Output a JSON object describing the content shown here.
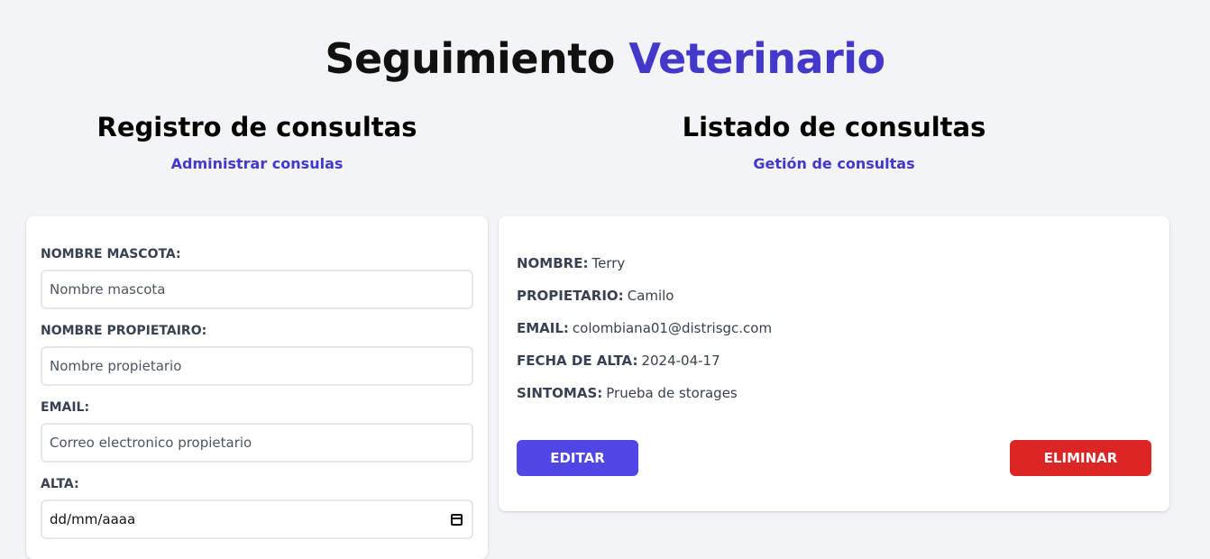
{
  "header": {
    "title_part1": "Seguimiento",
    "title_part2": "Veterinario"
  },
  "registro": {
    "title": "Registro de consultas",
    "subtitle": "Administrar consulas"
  },
  "listado": {
    "title": "Listado de consultas",
    "subtitle": "Getión de consultas"
  },
  "form": {
    "mascota": {
      "label": "Nombre Mascota:",
      "placeholder": "Nombre mascota"
    },
    "propietario": {
      "label": "Nombre Propietairo:",
      "placeholder": "Nombre propietario"
    },
    "email": {
      "label": "Email:",
      "placeholder": "Correo electronico propietario"
    },
    "alta": {
      "label": "Alta:",
      "value": "dd/mm/aaaa"
    }
  },
  "consulta": {
    "nombre": {
      "key": "Nombre:",
      "value": "Terry"
    },
    "propietario": {
      "key": "Propietario:",
      "value": "Camilo"
    },
    "email": {
      "key": "Email:",
      "value": "colombiana01@distrisgc.com"
    },
    "fecha": {
      "key": "Fecha de alta:",
      "value": "2024-04-17"
    },
    "sintomas": {
      "key": "Sintomas:",
      "value": "Prueba de storages"
    },
    "edit_label": "Editar",
    "delete_label": "Eliminar"
  },
  "colors": {
    "accent": "#4338ca",
    "edit_button": "#4f46e5",
    "delete_button": "#dc2626",
    "background": "#f3f4f6"
  }
}
